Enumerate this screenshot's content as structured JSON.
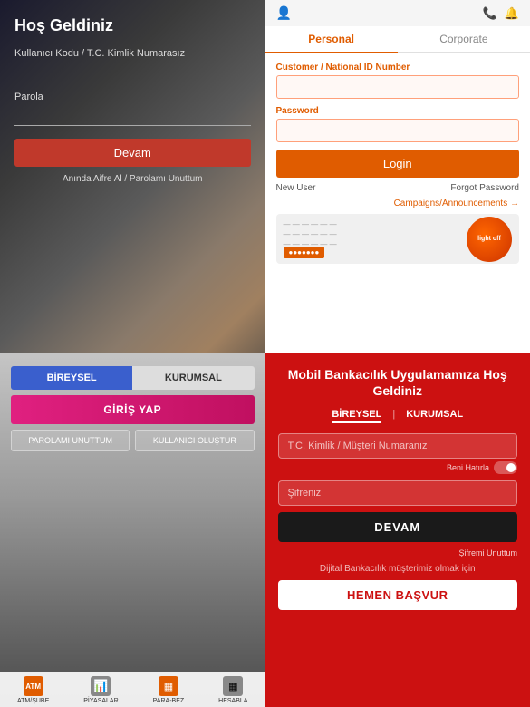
{
  "q1": {
    "title": "Hoş Geldiniz",
    "username_label": "Kullanıcı Kodu / T.C. Kimlik Numarasız",
    "password_label": "Parola",
    "btn_label": "Devam",
    "link_label": "Anında Aifre Al / Parolamı Unuttum"
  },
  "q2": {
    "header": {
      "person_icon": "👤",
      "phone_icon": "📞",
      "bell_icon": "🔔"
    },
    "tabs": [
      {
        "label": "Personal",
        "active": true
      },
      {
        "label": "Corporate",
        "active": false
      }
    ],
    "fields": {
      "id_label": "Customer / National ID Number",
      "id_placeholder": "",
      "password_label": "Password",
      "password_placeholder": ""
    },
    "login_btn": "Login",
    "new_user": "New User",
    "forgot_password": "Forgot Password",
    "campaigns_link": "Campaigns/Announcements →",
    "banner_circle_text": "light\noff"
  },
  "q3": {
    "tabs": [
      {
        "label": "BİREYSEL",
        "active": true
      },
      {
        "label": "KURUMSAL",
        "active": false
      }
    ],
    "main_btn": "GİRİŞ YAP",
    "btn1": "PAROLAMI UNUTTUM",
    "btn2": "KULLANICI OLUŞTUR",
    "nav": [
      {
        "icon": "ATM",
        "label": "ATM/ŞUBE",
        "highlight": true
      },
      {
        "icon": "📊",
        "label": "PİYASALAR",
        "highlight": false
      },
      {
        "icon": "▦",
        "label": "PARA-BEZ",
        "highlight": true
      },
      {
        "icon": "▦",
        "label": "HESABLA",
        "highlight": false
      }
    ]
  },
  "q4": {
    "title": "Mobil Bankacılık Uygulamamıza Hoş Geldiniz",
    "tabs": [
      {
        "label": "BİREYSEL",
        "active": true
      },
      {
        "label": "KURUMSAL",
        "active": false
      }
    ],
    "divider": "|",
    "id_placeholder": "T.C. Kimlik / Müşteri Numaranız",
    "remember_label": "Beni Hatırla",
    "password_placeholder": "Şifreniz",
    "devam_btn": "DEVAM",
    "forgot_link": "Şifremi Unuttum",
    "register_text": "Dijital Bankacılık müşterimiz olmak için",
    "apply_btn": "HEMEN BAŞVUR"
  }
}
